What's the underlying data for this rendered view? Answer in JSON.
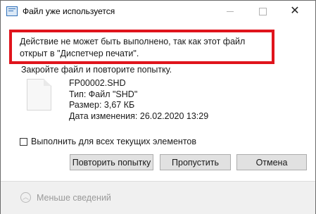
{
  "window": {
    "title": "Файл уже используется"
  },
  "message": {
    "error_text": "Действие не может быть выполнено, так как этот файл открыт в \"Диспетчер печати\".",
    "instruction": "Закройте файл и повторите попытку."
  },
  "file": {
    "name": "FP00002.SHD",
    "type": "Тип: Файл \"SHD\"",
    "size": "Размер: 3,67 КБ",
    "modified": "Дата изменения: 26.02.2020 13:29",
    "icon": "document-icon"
  },
  "options": {
    "apply_all_label": "Выполнить для всех текущих элементов",
    "apply_all_checked": false
  },
  "buttons": {
    "retry": "Повторить попытку",
    "skip": "Пропустить",
    "cancel": "Отмена"
  },
  "footer": {
    "less_details": "Меньше сведений"
  },
  "colors": {
    "highlight_border": "#e0141c",
    "button_bg": "#e1e1e1",
    "footer_bg": "#f0f0f0"
  }
}
